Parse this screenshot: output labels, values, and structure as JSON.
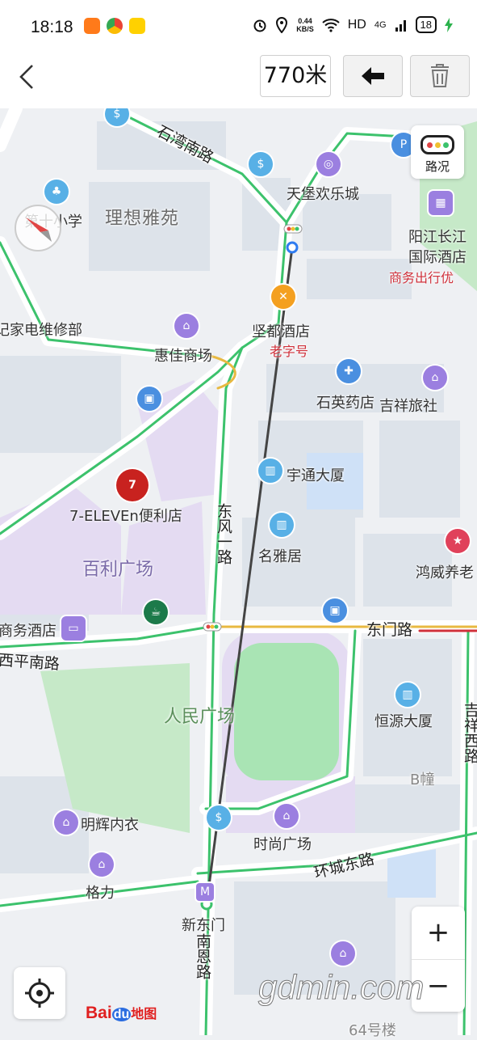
{
  "status_bar": {
    "time": "18:18",
    "net_speed_value": "0.44",
    "net_speed_unit": "KB/S",
    "hd": "HD",
    "signal": "4G",
    "battery": "18"
  },
  "toolbar": {
    "distance": "770米"
  },
  "map_controls": {
    "traffic_label": "路况",
    "zoom_in": "+",
    "zoom_out": "−",
    "brand_bai": "Bai",
    "brand_du": "du",
    "brand_map": "地图"
  },
  "watermark": "gdmin.com",
  "labels": {
    "shiwan_road": "石湾南路",
    "tianbao": "天堡欢乐城",
    "lixiang": "理想雅苑",
    "no10_school": "第十小学",
    "yangjiang_hotel_1": "阳江长江",
    "yangjiang_hotel_2": "国际酒店",
    "business_trip": "商务出行优",
    "appliance_repair": "记家电维修部",
    "jiandu_hotel": "坚都酒店",
    "laozihao": "老字号",
    "huijia": "惠佳商场",
    "shiying_pharmacy": "石英药店",
    "jixiang_inn": "吉祥旅社",
    "yutong": "宇通大厦",
    "seven_eleven": "7-ELEVEn便利店",
    "dongfeng_road": "东风一路",
    "mingya": "名雅居",
    "baili_plaza": "百利广场",
    "hongwei": "鸿威养老",
    "business_hotel": "商务酒店",
    "dongmen_road": "东门路",
    "xiping_road": "西平南路",
    "renmin_square": "人民广场",
    "hengyuan": "恒源大厦",
    "jixiang_west": "吉祥西路",
    "b_building": "B幢",
    "minghui": "明辉内衣",
    "shishang": "时尚广场",
    "huancheng_road": "环城东路",
    "geli": "格力",
    "xindongmen": "新东门",
    "nanen_road": "南恩路",
    "no64": "64号楼"
  }
}
